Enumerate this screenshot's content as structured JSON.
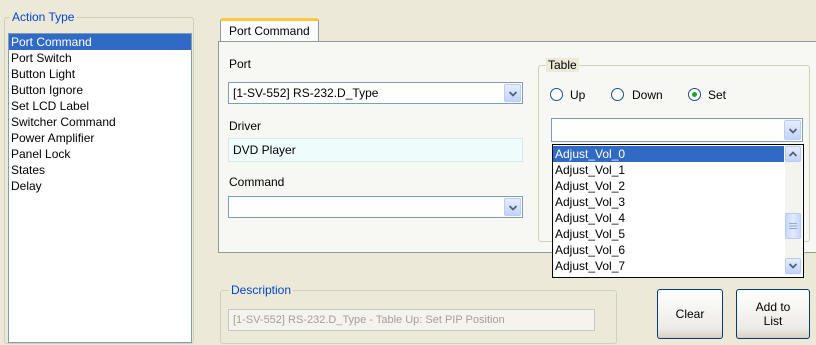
{
  "action_type": {
    "legend": "Action Type",
    "items": [
      "Port Command",
      "Port Switch",
      "Button Light",
      "Button Ignore",
      "Set LCD Label",
      "Switcher Command",
      "Power Amplifier",
      "Panel Lock",
      "States",
      "Delay"
    ],
    "selected_index": 0
  },
  "tab": {
    "label": "Port Command"
  },
  "port": {
    "label": "Port",
    "value": "[1-SV-552] RS-232.D_Type"
  },
  "driver": {
    "label": "Driver",
    "value": "DVD Player"
  },
  "command": {
    "label": "Command",
    "value": ""
  },
  "table": {
    "legend": "Table",
    "radios": [
      {
        "label": "Up",
        "checked": false
      },
      {
        "label": "Down",
        "checked": false
      },
      {
        "label": "Set",
        "checked": true
      }
    ],
    "combo_value": "",
    "dropdown_items": [
      "Adjust_Vol_0",
      "Adjust_Vol_1",
      "Adjust_Vol_2",
      "Adjust_Vol_3",
      "Adjust_Vol_4",
      "Adjust_Vol_5",
      "Adjust_Vol_6",
      "Adjust_Vol_7"
    ],
    "highlighted_index": 0
  },
  "description": {
    "legend": "Description",
    "value": "[1-SV-552] RS-232.D_Type - Table Up: Set PIP Position"
  },
  "buttons": {
    "clear": "Clear",
    "add_to_list": "Add to\nList"
  },
  "icons": {
    "dropdown_arrow": "chevron-down-icon",
    "scroll_up": "chevron-up-icon",
    "scroll_down": "chevron-down-icon"
  }
}
